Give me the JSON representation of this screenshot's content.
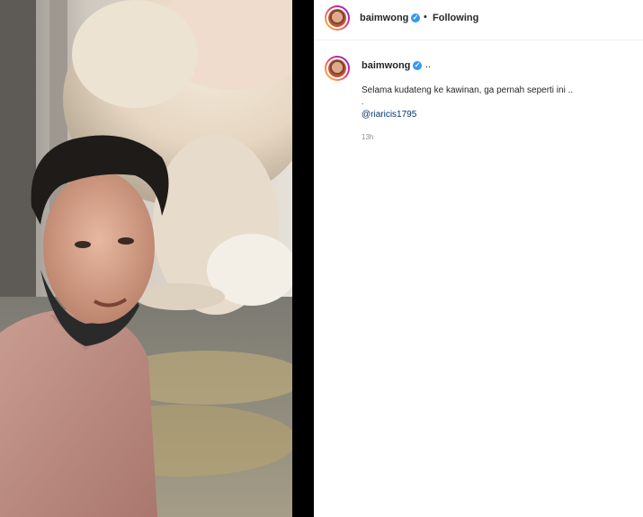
{
  "post": {
    "username": "baimwong",
    "verified_icon": "verified-badge-icon",
    "separator": "•",
    "follow_status": "Following"
  },
  "comment": {
    "username": "baimwong",
    "suffix": "..",
    "caption": "Selama kudateng ke kawinan, ga pernah seperti ini ..",
    "caption_extra": ".",
    "mention": "@riaricis1795",
    "timestamp": "13h"
  },
  "colors": {
    "accent_link": "#00376b",
    "verified_blue": "#3897f0",
    "muted_text": "#8e8e8e"
  }
}
